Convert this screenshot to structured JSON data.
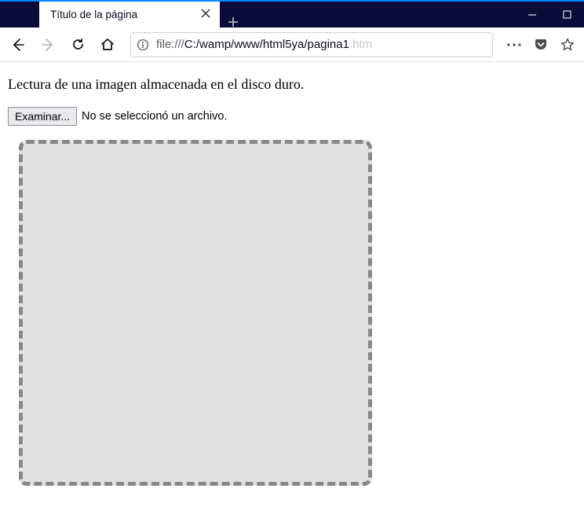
{
  "browser": {
    "tab_title": "Título de la página",
    "url_prefix": "file:///",
    "url_path": "C:/wamp/www/html5ya/pagina1",
    "url_fade": ".htm"
  },
  "page": {
    "heading": "Lectura de una imagen almacenada en el disco duro.",
    "file_button": "Examinar...",
    "file_status": "No se seleccionó un archivo."
  }
}
